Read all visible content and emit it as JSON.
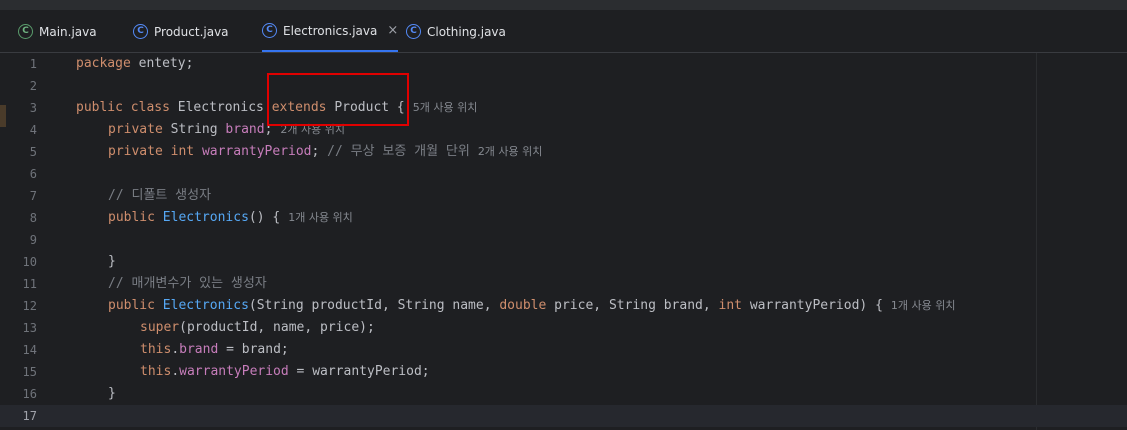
{
  "tabs": [
    {
      "label": "Main.java",
      "icon": "java-main-icon",
      "active": false
    },
    {
      "label": "Product.java",
      "icon": "java-class-icon",
      "active": false
    },
    {
      "label": "Electronics.java",
      "icon": "java-class-icon",
      "active": true
    },
    {
      "label": "Clothing.java",
      "icon": "java-class-icon",
      "active": false
    }
  ],
  "close_glyph": "×",
  "icon_glyph": "C",
  "editor": {
    "lines": [
      {
        "n": "1",
        "tokens": [
          [
            "kw",
            "package"
          ],
          [
            "",
            "entety;"
          ]
        ]
      },
      {
        "n": "2",
        "tokens": []
      },
      {
        "n": "3",
        "tokens": [
          [
            "kw",
            "public"
          ],
          [
            "kw",
            "class"
          ],
          [
            "",
            "Electronics"
          ],
          [
            "kw",
            "extends"
          ],
          [
            "",
            "Product {"
          ]
        ],
        "hint": "5개 사용 위치"
      },
      {
        "n": "4",
        "tokens": [
          [
            "kw",
            "private"
          ],
          [
            "",
            "String"
          ],
          [
            "fld",
            "brand"
          ],
          [
            "",
            ";"
          ]
        ],
        "hint": "2개 사용 위치"
      },
      {
        "n": "5",
        "tokens": [
          [
            "kw",
            "private"
          ],
          [
            "kw",
            "int"
          ],
          [
            "fld",
            "warrantyPeriod"
          ],
          [
            "",
            ";"
          ],
          [
            "cm",
            "// 무상 보증 개월 단위"
          ]
        ],
        "hint": "2개 사용 위치"
      },
      {
        "n": "6",
        "tokens": []
      },
      {
        "n": "7",
        "tokens": [
          [
            "cm",
            "// 디폴트 생성자"
          ]
        ]
      },
      {
        "n": "8",
        "tokens": [
          [
            "kw",
            "public"
          ],
          [
            "fn",
            "Electronics"
          ],
          [
            "",
            "() {"
          ]
        ],
        "hint": "1개 사용 위치"
      },
      {
        "n": "9",
        "tokens": []
      },
      {
        "n": "10",
        "tokens": [
          [
            "",
            "}"
          ]
        ]
      },
      {
        "n": "11",
        "tokens": [
          [
            "cm",
            "// 매개변수가 있는 생성자"
          ]
        ]
      },
      {
        "n": "12",
        "tokens": [
          [
            "kw",
            "public"
          ],
          [
            "fn",
            "Electronics"
          ],
          [
            "",
            "(String productId, String name,"
          ],
          [
            "kw",
            "double"
          ],
          [
            "",
            "price, String brand,"
          ],
          [
            "kw",
            "int"
          ],
          [
            "",
            "warrantyPeriod) {"
          ]
        ],
        "hint": "1개 사용 위치"
      },
      {
        "n": "13",
        "tokens": [
          [
            "kw",
            "super"
          ],
          [
            "",
            "(productId, name, price);"
          ]
        ]
      },
      {
        "n": "14",
        "tokens": [
          [
            "kw",
            "this"
          ],
          [
            "",
            "."
          ],
          [
            "fld",
            "brand"
          ],
          [
            "",
            "= brand;"
          ]
        ]
      },
      {
        "n": "15",
        "tokens": [
          [
            "kw",
            "this"
          ],
          [
            "",
            "."
          ],
          [
            "fld",
            "warrantyPeriod"
          ],
          [
            "",
            "= warrantyPeriod;"
          ]
        ]
      },
      {
        "n": "16",
        "tokens": [
          [
            "",
            "}"
          ]
        ]
      },
      {
        "n": "17",
        "tokens": []
      }
    ]
  }
}
